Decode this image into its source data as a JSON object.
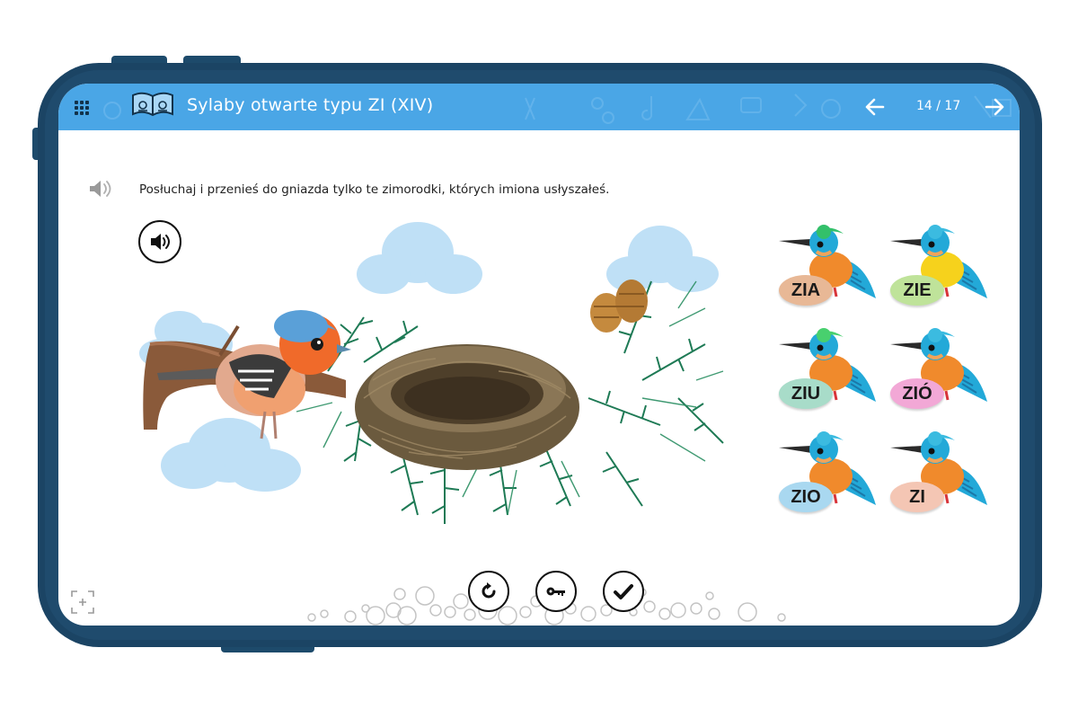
{
  "header": {
    "title": "Sylaby otwarte typu ZI (XIV)",
    "page_counter": "14 / 17"
  },
  "exercise": {
    "instruction": "Posłuchaj i przenieś do gniazda tylko te zimorodki, których imiona usłyszałeś."
  },
  "birds": [
    {
      "label": "ZIA",
      "label_color": "#e8b896",
      "crest_color": "#33c06a",
      "breast_color": "#f08a2c"
    },
    {
      "label": "ZIE",
      "label_color": "#bfe39a",
      "crest_color": "#3bbbe0",
      "breast_color": "#f6d21c"
    },
    {
      "label": "ZIU",
      "label_color": "#a8dcc9",
      "crest_color": "#48d06e",
      "breast_color": "#f08a2c"
    },
    {
      "label": "ZIÓ",
      "label_color": "#f2a8d6",
      "crest_color": "#3bbbe0",
      "breast_color": "#f08a2c"
    },
    {
      "label": "ZIO",
      "label_color": "#a9d8f0",
      "crest_color": "#3bbbe0",
      "breast_color": "#f08a2c"
    },
    {
      "label": "ZI",
      "label_color": "#f4c6b4",
      "crest_color": "#3bbbe0",
      "breast_color": "#f08a2c"
    }
  ],
  "colors": {
    "header_bar": "#4aa6e6",
    "tablet_frame": "#1b4464",
    "kingfisher_body": "#23a9d8"
  },
  "icons": {
    "menu": "grid-menu-icon",
    "book": "open-book-icon",
    "prev": "arrow-left-icon",
    "next": "arrow-right-icon",
    "audio": "speaker-icon",
    "reset": "reset-icon",
    "key": "key-icon",
    "check": "check-icon",
    "fullscreen": "fullscreen-icon"
  }
}
